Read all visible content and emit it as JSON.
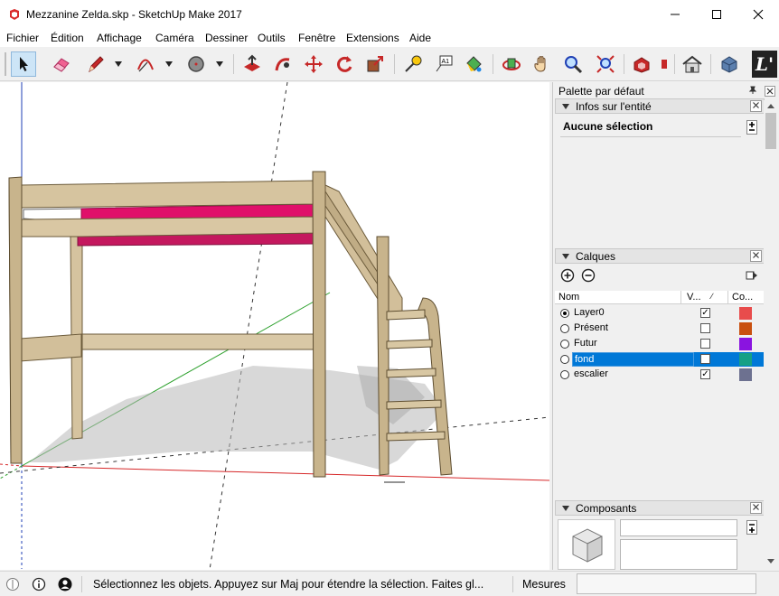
{
  "window": {
    "title": "Mezzanine Zelda.skp - SketchUp Make 2017",
    "minimize_glyph": "—",
    "maximize_glyph": "☐",
    "close_glyph": "✕"
  },
  "menu": [
    "Fichier",
    "Édition",
    "Affichage",
    "Caméra",
    "Dessiner",
    "Outils",
    "Fenêtre",
    "Extensions",
    "Aide"
  ],
  "toolbar": {
    "tools": [
      "select-tool",
      "eraser-tool",
      "pencil-line-tool",
      "arc-tool",
      "circle-tool",
      "push-pull-tool",
      "follow-me-tool",
      "move-tool",
      "rotate-tool",
      "scale-tool",
      "tape-measure-tool",
      "text-tool",
      "paint-bucket-tool",
      "orbit-tool",
      "pan-tool",
      "zoom-tool",
      "zoom-extents-tool",
      "3d-warehouse-tool",
      "extension-warehouse-tool",
      "layout-tool"
    ],
    "text_tool_label": "A1",
    "layout_label": "L'"
  },
  "tray": {
    "title": "Palette par défaut",
    "pin_glyph": "🖈",
    "close_glyph": "✕",
    "entity_info": {
      "header": "Infos sur l'entité",
      "selection": "Aucune sélection"
    },
    "layers": {
      "header": "Calques",
      "columns": {
        "name": "Nom",
        "visible": "V...",
        "color": "Co..."
      },
      "rows": [
        {
          "name": "Layer0",
          "active": true,
          "visible": true,
          "color": "#e84c4c",
          "selected": false
        },
        {
          "name": "Présent",
          "active": false,
          "visible": false,
          "color": "#c9500f",
          "selected": false
        },
        {
          "name": "Futur",
          "active": false,
          "visible": false,
          "color": "#8a14e0",
          "selected": false
        },
        {
          "name": "fond",
          "active": false,
          "visible": false,
          "color": "#16a085",
          "selected": true
        },
        {
          "name": "escalier",
          "active": false,
          "visible": true,
          "color": "#6d7190",
          "selected": false
        }
      ]
    },
    "components": {
      "header": "Composants"
    }
  },
  "status": {
    "message": "Sélectionnez les objets. Appuyez sur Maj pour étendre la sélection. Faites gl...",
    "measures_label": "Mesures",
    "measures_value": ""
  },
  "colors": {
    "selection_blue": "#0078d7",
    "wood": "#c8b48c",
    "mattress_pink": "#e0106a",
    "axis_green": "#2ca02c",
    "axis_red": "#d62728",
    "axis_blue": "#1f3fb4"
  }
}
